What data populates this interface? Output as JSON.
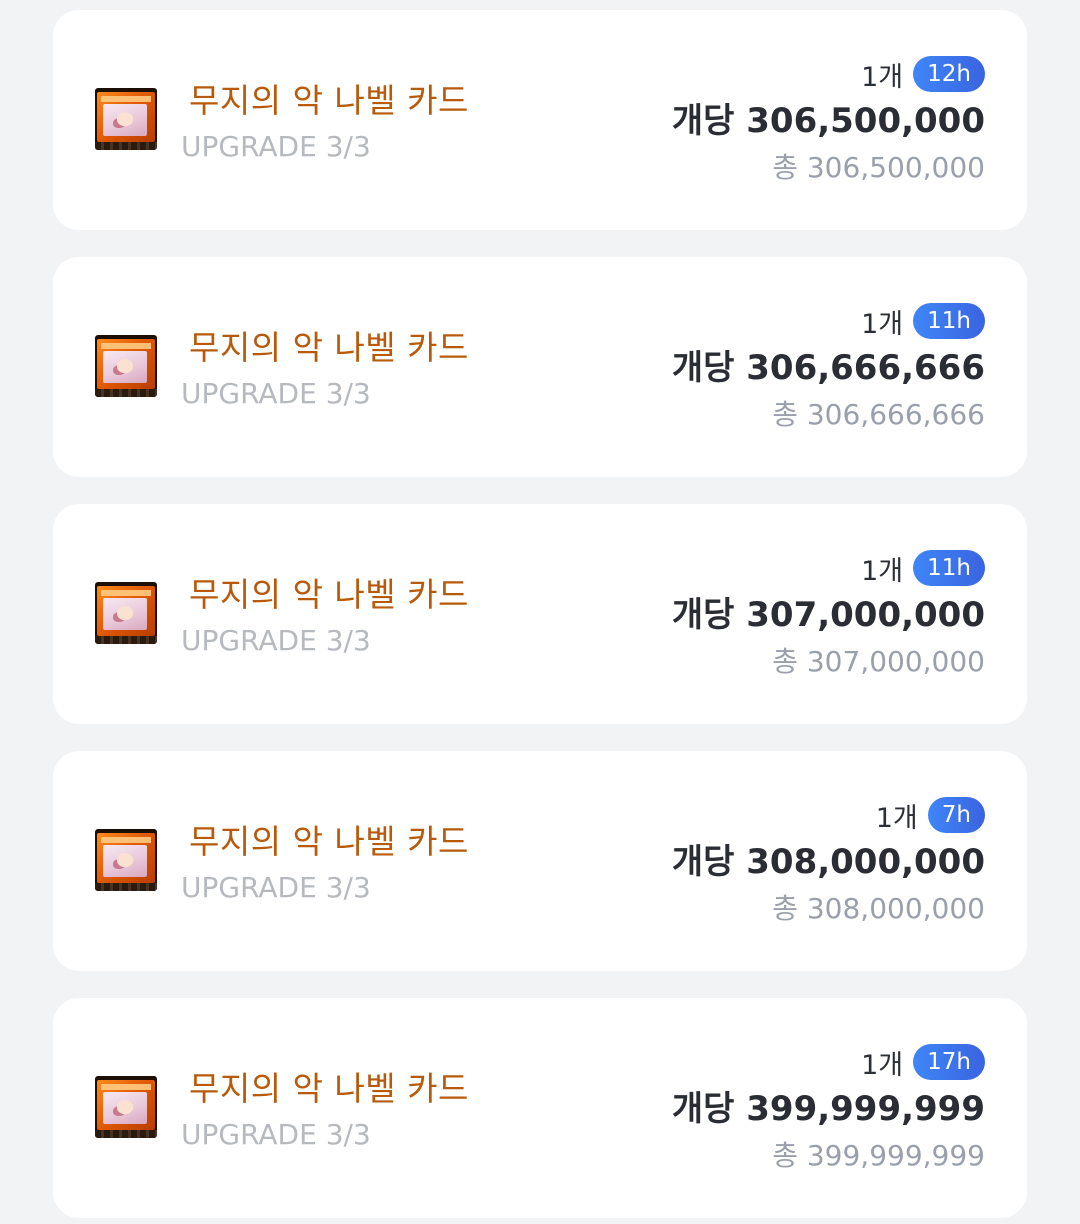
{
  "listings": [
    {
      "name": "무지의 악 나벨 카드",
      "upgrade": "UPGRADE 3/3",
      "quantity": "1개",
      "time_badge": "12h",
      "price_label": "개당",
      "price": "306,500,000",
      "total_label": "총",
      "total": "306,500,000",
      "icon": "nabel-card-icon"
    },
    {
      "name": "무지의 악 나벨 카드",
      "upgrade": "UPGRADE 3/3",
      "quantity": "1개",
      "time_badge": "11h",
      "price_label": "개당",
      "price": "306,666,666",
      "total_label": "총",
      "total": "306,666,666",
      "icon": "nabel-card-icon"
    },
    {
      "name": "무지의 악 나벨 카드",
      "upgrade": "UPGRADE 3/3",
      "quantity": "1개",
      "time_badge": "11h",
      "price_label": "개당",
      "price": "307,000,000",
      "total_label": "총",
      "total": "307,000,000",
      "icon": "nabel-card-icon"
    },
    {
      "name": "무지의 악 나벨 카드",
      "upgrade": "UPGRADE 3/3",
      "quantity": "1개",
      "time_badge": "7h",
      "price_label": "개당",
      "price": "308,000,000",
      "total_label": "총",
      "total": "308,000,000",
      "icon": "nabel-card-icon"
    },
    {
      "name": "무지의 악 나벨 카드",
      "upgrade": "UPGRADE 3/3",
      "quantity": "1개",
      "time_badge": "17h",
      "price_label": "개당",
      "price": "399,999,999",
      "total_label": "총",
      "total": "399,999,999",
      "icon": "nabel-card-icon"
    }
  ],
  "colors": {
    "background": "#f2f3f5",
    "card": "#ffffff",
    "item_name": "#b85a0a",
    "upgrade_text": "#b6b9be",
    "badge": "#3f86f7",
    "price_text": "#2a2d33",
    "total_text": "#9aa0ab"
  }
}
